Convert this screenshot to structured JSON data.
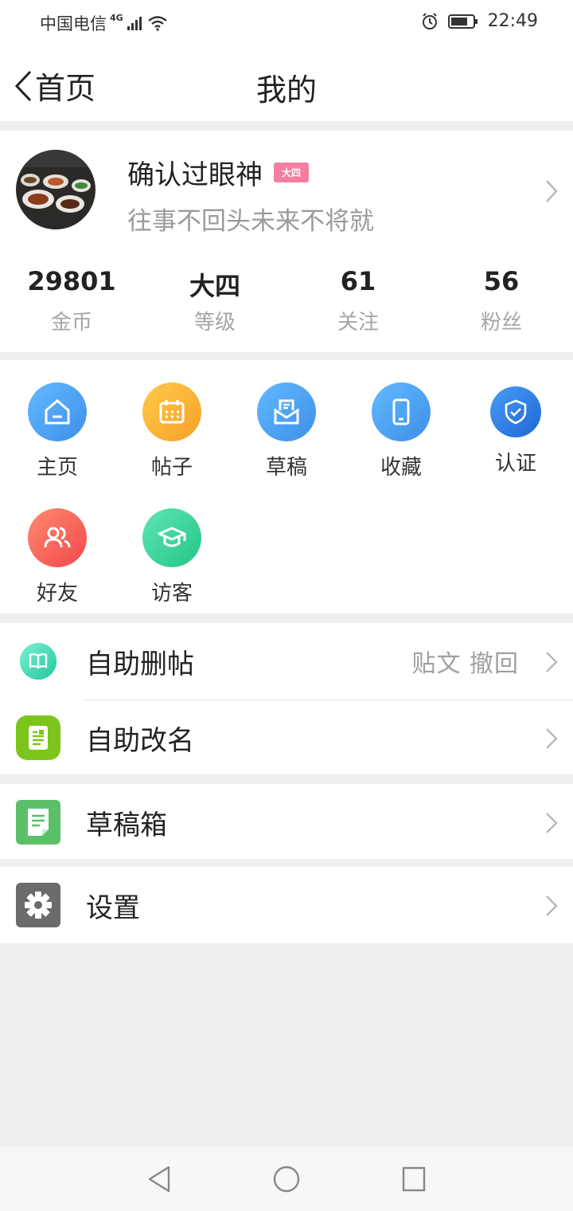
{
  "status_bar": {
    "carrier": "中国电信",
    "network": "4G",
    "time": "22:49"
  },
  "header": {
    "back_label": "首页",
    "title": "我的"
  },
  "profile": {
    "username": "确认过眼神",
    "level_badge": "大四",
    "signature": "往事不回头未来不将就",
    "stats": [
      {
        "value": "29801",
        "label": "金币"
      },
      {
        "value": "大四",
        "label": "等级"
      },
      {
        "value": "61",
        "label": "关注"
      },
      {
        "value": "56",
        "label": "粉丝"
      }
    ]
  },
  "shortcuts": [
    {
      "label": "主页",
      "icon": "home-icon",
      "color": "#4aa3f0"
    },
    {
      "label": "帖子",
      "icon": "calendar-icon",
      "color": "#fbb33a"
    },
    {
      "label": "草稿",
      "icon": "mail-draft-icon",
      "color": "#4aa3f0"
    },
    {
      "label": "收藏",
      "icon": "phone-icon",
      "color": "#4aa3f0"
    },
    {
      "label": "认证",
      "icon": "shield-check-icon",
      "color": "#2f80e8"
    },
    {
      "label": "好友",
      "icon": "friends-icon",
      "color": "#f25f5c"
    },
    {
      "label": "访客",
      "icon": "graduation-cap-icon",
      "color": "#3dd39a"
    }
  ],
  "list": {
    "self_delete": {
      "label": "自助删帖",
      "right_text": "贴文  撤回"
    },
    "self_rename": {
      "label": "自助改名"
    },
    "drafts_box": {
      "label": "草稿箱"
    },
    "settings": {
      "label": "设置"
    }
  }
}
